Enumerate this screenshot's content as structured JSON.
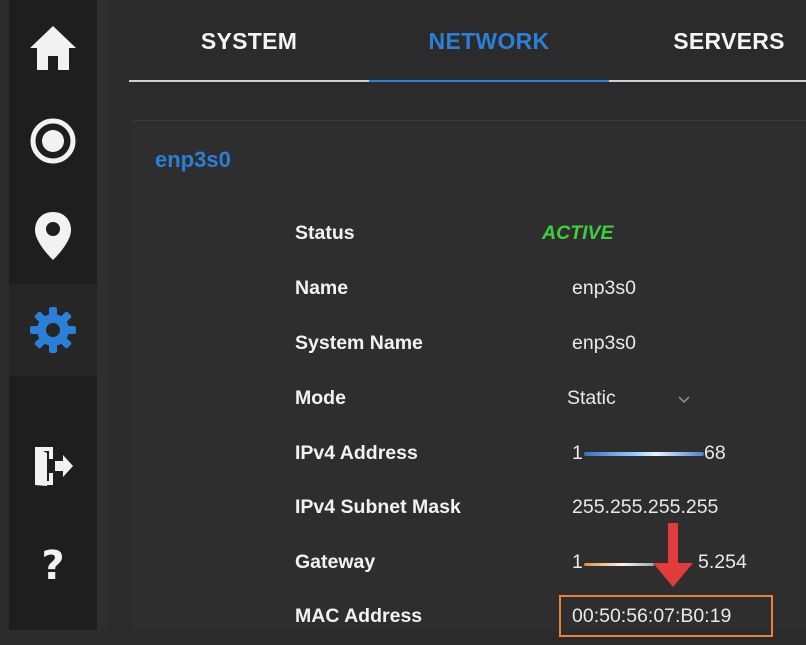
{
  "sidebar": {
    "items": [
      {
        "name": "home",
        "icon": "home-icon"
      },
      {
        "name": "record",
        "icon": "radio-icon"
      },
      {
        "name": "location",
        "icon": "map-pin-icon"
      },
      {
        "name": "settings",
        "icon": "gear-icon",
        "active": true
      },
      {
        "name": "logout",
        "icon": "exit-icon"
      },
      {
        "name": "help",
        "icon": "help-icon",
        "glyph": "?"
      }
    ]
  },
  "tabs": [
    {
      "label": "SYSTEM"
    },
    {
      "label": "NETWORK",
      "active": true
    },
    {
      "label": "SERVERS"
    }
  ],
  "interface": {
    "title": "enp3s0",
    "status_label": "Status",
    "status_value": "ACTIVE",
    "name_label": "Name",
    "name_value": "enp3s0",
    "system_name_label": "System Name",
    "system_name_value": "enp3s0",
    "mode_label": "Mode",
    "mode_value": "Static",
    "ipv4_label": "IPv4 Address",
    "ipv4_prefix": "1",
    "ipv4_suffix": "68",
    "subnet_label": "IPv4 Subnet Mask",
    "subnet_value": "255.255.255.255",
    "gateway_label": "Gateway",
    "gateway_prefix": "1",
    "gateway_suffix": "5.254",
    "mac_label": "MAC Address",
    "mac_value": "00:50:56:07:B0:19"
  },
  "colors": {
    "accent": "#2b7fd6",
    "active_status": "#3ecf3e",
    "highlight_box": "#e8813a",
    "arrow": "#e23b3b"
  }
}
